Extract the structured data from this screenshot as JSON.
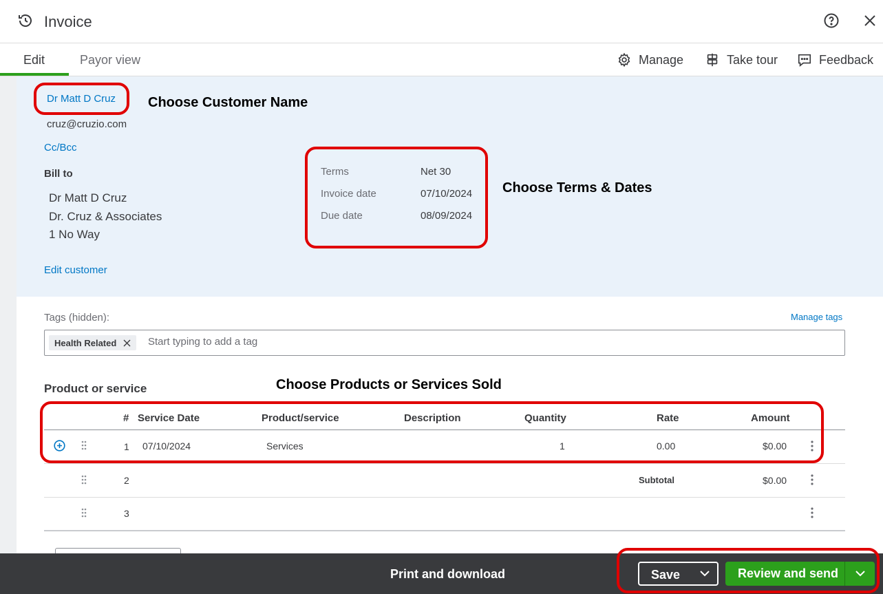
{
  "window": {
    "title": "Invoice"
  },
  "tabs": [
    {
      "label": "Edit",
      "active": true
    },
    {
      "label": "Payor view",
      "active": false
    }
  ],
  "toolbar": {
    "manage": "Manage",
    "take_tour": "Take tour",
    "feedback": "Feedback"
  },
  "customer": {
    "name": "Dr Matt D Cruz",
    "email": "cruz@cruzio.com",
    "cc_bcc": "Cc/Bcc",
    "bill_to_label": "Bill to",
    "bill_to_lines": [
      "Dr Matt D Cruz",
      "Dr. Cruz & Associates",
      "1 No Way"
    ],
    "edit_link": "Edit customer"
  },
  "terms": {
    "terms_label": "Terms",
    "terms_value": "Net 30",
    "invoice_date_label": "Invoice date",
    "invoice_date_value": "07/10/2024",
    "due_date_label": "Due date",
    "due_date_value": "08/09/2024"
  },
  "annotations": {
    "customer": "Choose Customer Name",
    "terms": "Choose Terms & Dates",
    "products": "Choose Products or Services Sold"
  },
  "tags": {
    "label": "Tags (hidden):",
    "manage": "Manage tags",
    "chip": "Health Related",
    "placeholder": "Start typing to add a tag"
  },
  "products": {
    "section_title": "Product or service",
    "columns": [
      "#",
      "Service Date",
      "Product/service",
      "Description",
      "Quantity",
      "Rate",
      "Amount"
    ],
    "rows": [
      {
        "num": "1",
        "service_date": "07/10/2024",
        "product": "Services",
        "description": "",
        "quantity": "1",
        "rate": "0.00",
        "amount": "$0.00"
      },
      {
        "num": "2",
        "subtotal_label": "Subtotal",
        "amount": "$0.00"
      },
      {
        "num": "3"
      }
    ]
  },
  "footer": {
    "print": "Print and download",
    "save": "Save",
    "review": "Review and send"
  },
  "colors": {
    "accent_green": "#2ca01c",
    "link_blue": "#0077c5",
    "annotation_red": "#e00000",
    "footer_bg": "#393a3d"
  }
}
